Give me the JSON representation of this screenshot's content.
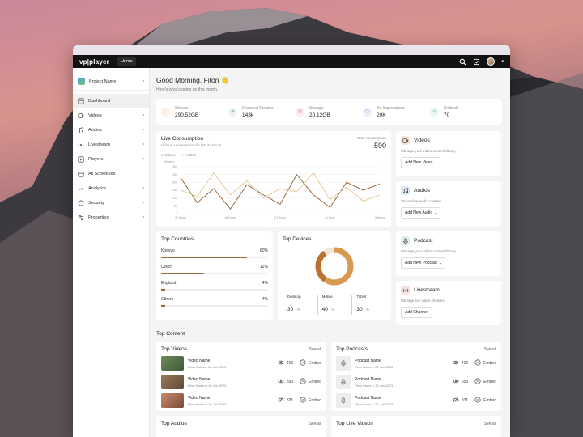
{
  "app": {
    "logo": "vp|player",
    "tab": "Home"
  },
  "sidebar": {
    "project": "Project Name",
    "items": [
      {
        "label": "Dashboard",
        "icon": "dashboard-icon",
        "active": true,
        "chevron": false
      },
      {
        "label": "Videos",
        "icon": "video-icon",
        "chevron": true
      },
      {
        "label": "Audios",
        "icon": "audio-icon",
        "chevron": true
      },
      {
        "label": "Livestream",
        "icon": "livestream-icon",
        "chevron": true
      },
      {
        "label": "Players",
        "icon": "player-icon",
        "chevron": true
      },
      {
        "label": "All Schedules",
        "icon": "schedule-icon",
        "chevron": false
      },
      {
        "label": "Analytics",
        "icon": "analytics-icon",
        "chevron": true
      },
      {
        "label": "Security",
        "icon": "security-icon",
        "chevron": true
      },
      {
        "label": "Properties",
        "icon": "properties-icon",
        "chevron": true
      }
    ]
  },
  "greeting": {
    "title": "Good Morning, Fiton 👋",
    "subtitle": "Here's what's going on this month."
  },
  "stats": [
    {
      "label": "Stream",
      "value": "290.52GB",
      "color": "#e69a55"
    },
    {
      "label": "Encoded Minutes",
      "value": "143k",
      "color": "#7bb37b"
    },
    {
      "label": "Storage",
      "value": "20.12GB",
      "color": "#e07a7a"
    },
    {
      "label": "Ad Impressions",
      "value": "20K",
      "color": "#6a96d8"
    },
    {
      "label": "Embeds",
      "value": "70",
      "color": "#6bbd8a"
    }
  ],
  "live": {
    "title": "Live Consumption",
    "subtitle": "Unique consumption for last 24 hours",
    "total_label": "Total consumption",
    "total": "590",
    "legend": [
      "Videos",
      "Audios"
    ]
  },
  "chart_data": {
    "type": "line",
    "x": [
      "24 Hours",
      "18 Hours",
      "12 Hours",
      "6 Hours",
      "0 Hours"
    ],
    "ylabel": "Viewers",
    "y_ticks": [
      "0",
      "50",
      "100",
      "150",
      "200",
      "250",
      "300"
    ],
    "ylim": [
      0,
      300
    ],
    "series": [
      {
        "name": "Videos",
        "color": "#9a6a3e",
        "values": [
          230,
          70,
          160,
          30,
          185,
          120,
          60,
          250,
          120,
          40,
          200,
          150,
          190
        ]
      },
      {
        "name": "Audios",
        "color": "#e8c9a0",
        "values": [
          150,
          110,
          260,
          120,
          210,
          100,
          160,
          140,
          260,
          90,
          170,
          80,
          120
        ]
      }
    ]
  },
  "right_cards": [
    {
      "title": "Videos",
      "desc": "Manage your video content library.",
      "button": "Add New Video",
      "icon": "video-icon",
      "color": "#f5e6cf",
      "has_dropdown": true
    },
    {
      "title": "Audios",
      "desc": "Streamline audio content.",
      "button": "Add New Audio",
      "icon": "audio-icon",
      "color": "#dbe6f7",
      "has_dropdown": true
    },
    {
      "title": "Podcast",
      "desc": "Manage your video content library.",
      "button": "Add New Podcast",
      "icon": "podcast-icon",
      "color": "#dff0e2",
      "has_dropdown": true
    },
    {
      "title": "Livestream",
      "desc": "Manage live video streams.",
      "button": "Add Channel",
      "icon": "livestream-icon",
      "color": "#f7e0e0",
      "has_dropdown": false
    }
  ],
  "top_countries": {
    "title": "Top Countries",
    "items": [
      {
        "name": "Kosovo",
        "pct": "80%",
        "value": 0.8
      },
      {
        "name": "Czech",
        "pct": "12%",
        "value": 0.4
      },
      {
        "name": "England",
        "pct": "4%",
        "value": 0.04
      },
      {
        "name": "Others",
        "pct": "4%",
        "value": 0.04
      }
    ]
  },
  "top_devices": {
    "title": "Top Devices",
    "items": [
      {
        "name": "Desktop",
        "value": "30",
        "unit": "%"
      },
      {
        "name": "Mobile",
        "value": "40",
        "unit": "%"
      },
      {
        "name": "Tablet",
        "value": "30",
        "unit": "%"
      }
    ]
  },
  "top_content": {
    "title": "Top Content",
    "see_all": "See all",
    "top_videos": {
      "title": "Top Videos",
      "items": [
        {
          "name": "Video Name",
          "author": "Fiton Kadriu",
          "date": "26 Jun 2023",
          "views": "400",
          "embed": "Embed",
          "view_icon": "eye-icon"
        },
        {
          "name": "Video Name",
          "author": "Fiton Kadriu",
          "date": "26 Jun 2023",
          "views": "553",
          "embed": "Embed",
          "view_icon": "eye-icon"
        },
        {
          "name": "Video Name",
          "author": "Fiton Kadriu",
          "date": "26 Jun 2023",
          "views": "331",
          "embed": "Embed",
          "view_icon": "eye-off-icon"
        }
      ]
    },
    "top_podcasts": {
      "title": "Top Podcasts",
      "items": [
        {
          "name": "Podcast Name",
          "author": "Fiton Kadriu",
          "date": "26 Jun 2023",
          "views": "400",
          "embed": "Embed",
          "view_icon": "eye-icon"
        },
        {
          "name": "Podcast Name",
          "author": "Fiton Kadriu",
          "date": "26 Jun 2023",
          "views": "553",
          "embed": "Embed",
          "view_icon": "eye-icon"
        },
        {
          "name": "Podcast Name",
          "author": "Fiton Kadriu",
          "date": "26 Jun 2023",
          "views": "331",
          "embed": "Embed",
          "view_icon": "eye-off-icon"
        }
      ]
    },
    "top_audios_title": "Top Audios",
    "top_live_title": "Top Live Videos"
  }
}
